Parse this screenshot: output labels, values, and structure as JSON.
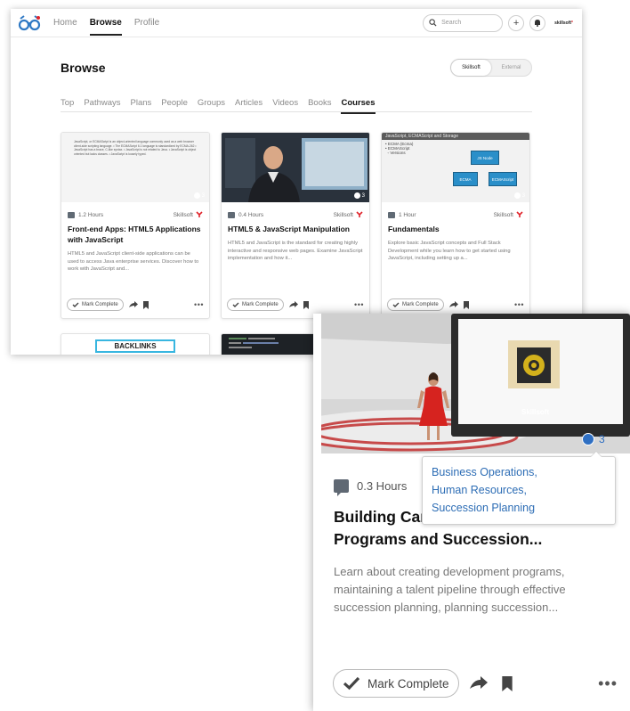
{
  "nav": {
    "items": [
      "Home",
      "Browse",
      "Profile"
    ],
    "active": "Browse"
  },
  "search": {
    "placeholder": "Search"
  },
  "header": {
    "plus": "+",
    "brand_prefix": "skillsoft",
    "brand_suffix": "*"
  },
  "page": {
    "title": "Browse"
  },
  "toggle": {
    "options": [
      "Skillsoft",
      "External"
    ],
    "active": "Skillsoft"
  },
  "tabs": [
    "Top",
    "Pathways",
    "Plans",
    "People",
    "Groups",
    "Articles",
    "Videos",
    "Books",
    "Courses"
  ],
  "active_tab": "Courses",
  "cards": [
    {
      "duration": "1.2 Hours",
      "provider": "Skillsoft",
      "title": "Front-end Apps: HTML5 Applications with JavaScript",
      "description": "HTML5 and JavaScript client-side applications can be used to access Java enterprise services. Discover how to work with JavaScript and...",
      "topic_count": "3",
      "thumb_text": "JavaScript, or ECMAScript is an object-oriented language commonly used as a web browser client-side scripting language. • The ECMAScript 6.1 language is standardized by ECMA-262 • JavaScript has a brace, C-like syntax. • JavaScript is not related to Java. • JavaScript is object oriented but lacks classes. • JavaScript is loosely typed."
    },
    {
      "duration": "0.4 Hours",
      "provider": "Skillsoft",
      "title": "HTML5 & JavaScript Manipulation",
      "description": "HTML5 and JavaScript is the standard for creating highly interactive and responsive web pages. Examine JavaScript implementation and how it...",
      "topic_count": "3"
    },
    {
      "duration": "1 Hour",
      "provider": "Skillsoft",
      "title": "Fundamentals",
      "description": "Explore basic JavaScript concepts and Full Stack Development while you learn how to get started using JavaScript, including setting up a...",
      "topic_count": "3",
      "thumb_header": "JavaScript, ECMAScript and Storage",
      "thumb_bullets": [
        "• ECMA (Ecma)",
        "• ECMAScript",
        "  ◦ Versions"
      ],
      "thumb_boxes": [
        "JS Node",
        "ECMA",
        "ECMAScript"
      ]
    }
  ],
  "card_actions": {
    "mark_complete": "Mark Complete",
    "more": "•••"
  },
  "next_row": {
    "card_a_text": "BACKLINKS"
  },
  "zoom_card": {
    "duration": "0.3 Hours",
    "title": "Building Career Development Programs and Succession...",
    "title_visible_part1": "Building Car",
    "title_visible_part2": "Programs and Succession...",
    "description": "Learn about creating development programs, maintaining a talent pipeline through effective succession planning, planning succession...",
    "topic_count": "3",
    "screen_brand": "Skillsoft",
    "mark_complete": "Mark Complete",
    "more": "•••"
  },
  "tooltip": {
    "topics": [
      "Business Operations,",
      "Human Resources,",
      "Succession Planning"
    ]
  },
  "colors": {
    "accent": "#e0242b",
    "link": "#2d6db5",
    "topic_icon": "#2f6fc2",
    "presenter_dress": "#d6231f"
  }
}
